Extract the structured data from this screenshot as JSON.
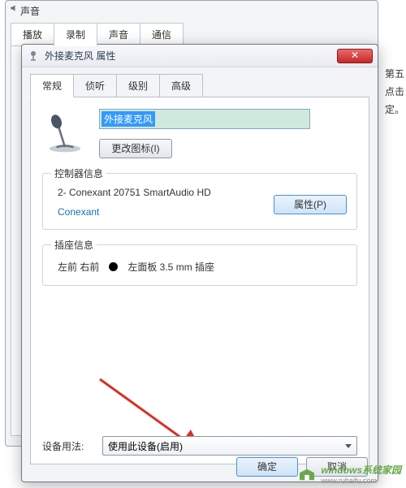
{
  "parent": {
    "title": "声音",
    "tabs": [
      "播放",
      "录制",
      "声音",
      "通信"
    ],
    "active_tab_index": 1
  },
  "dialog": {
    "title": "外接麦克风 属性",
    "close_glyph": "✕",
    "tabs": [
      "常规",
      "侦听",
      "级别",
      "高级"
    ],
    "active_tab_index": 0,
    "device_name": "外接麦克风",
    "change_icon_btn": "更改图标(I)",
    "controller_group": {
      "legend": "控制器信息",
      "name": "2- Conexant 20751 SmartAudio HD",
      "vendor": "Conexant",
      "properties_btn": "属性(P)"
    },
    "jack_group": {
      "legend": "插座信息",
      "location": "左前 右前",
      "desc": "左面板 3.5 mm 插座"
    },
    "usage": {
      "label": "设备用法:",
      "value": "使用此设备(启用)"
    },
    "ok_btn": "确定",
    "cancel_btn": "取消"
  },
  "side_text": [
    "第五",
    "点击",
    "定。"
  ],
  "watermark": "windows系统家园",
  "watermark_url": "www.ruhaifu.com"
}
